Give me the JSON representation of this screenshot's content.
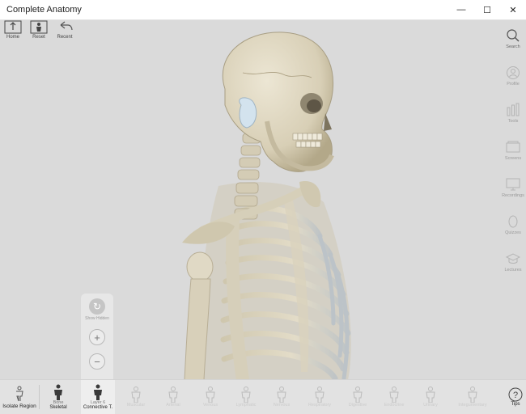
{
  "window": {
    "title": "Complete Anatomy",
    "minimize": "—",
    "maximize": "☐",
    "close": "✕"
  },
  "top_tools": [
    {
      "label": "Home",
      "icon": "home-icon"
    },
    {
      "label": "Reset",
      "icon": "reset-icon"
    },
    {
      "label": "Recent",
      "icon": "undo-icon"
    }
  ],
  "right_rail": [
    {
      "label": "Search",
      "icon": "search-icon",
      "enabled": true
    },
    {
      "label": "Profile",
      "icon": "profile-icon",
      "enabled": false
    },
    {
      "label": "Tools",
      "icon": "tools-icon",
      "enabled": false
    },
    {
      "label": "Screens",
      "icon": "screens-icon",
      "enabled": false
    },
    {
      "label": "Recordings",
      "icon": "recordings-icon",
      "enabled": false
    },
    {
      "label": "Quizzes",
      "icon": "quizzes-icon",
      "enabled": false
    },
    {
      "label": "Lectures",
      "icon": "lectures-icon",
      "enabled": false
    }
  ],
  "zoom_panel": {
    "show_label": "Show Hidden",
    "zoom_in": "+",
    "zoom_out": "−"
  },
  "bottom_bar": {
    "isolate_label": "Isolate Region",
    "bone_line1": "Bone",
    "bone_line2": "Skeletal",
    "layer_line1": "Layer 6",
    "layer_line2": "Connective T.",
    "faded_layers": [
      "Muscular",
      "Arterial",
      "Venous",
      "Lymphatic",
      "Nervous",
      "Respiratory",
      "Digestive",
      "Endocrine",
      "Urinary",
      "Integumentary"
    ],
    "tips_label": "Tips"
  },
  "colors": {
    "background": "#dadada",
    "bone": "#ded7c3",
    "bone_shadow": "#b8ae95"
  }
}
